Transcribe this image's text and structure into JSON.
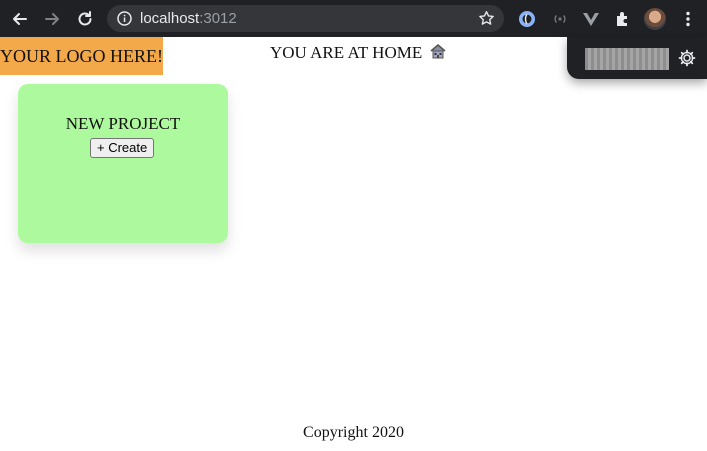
{
  "browser": {
    "url_host": "localhost",
    "url_port": ":3012"
  },
  "page": {
    "logo_text": "YOUR LOGO HERE!",
    "home_title": "YOU ARE AT HOME",
    "home_icon": "house-icon",
    "footer_text": "Copyright 2020"
  },
  "card": {
    "title": "NEW PROJECT",
    "create_button_label": "+ Create"
  },
  "colors": {
    "logo_bg": "#f3a94a",
    "card_bg": "#adf99e",
    "chrome_bg": "#202124"
  }
}
